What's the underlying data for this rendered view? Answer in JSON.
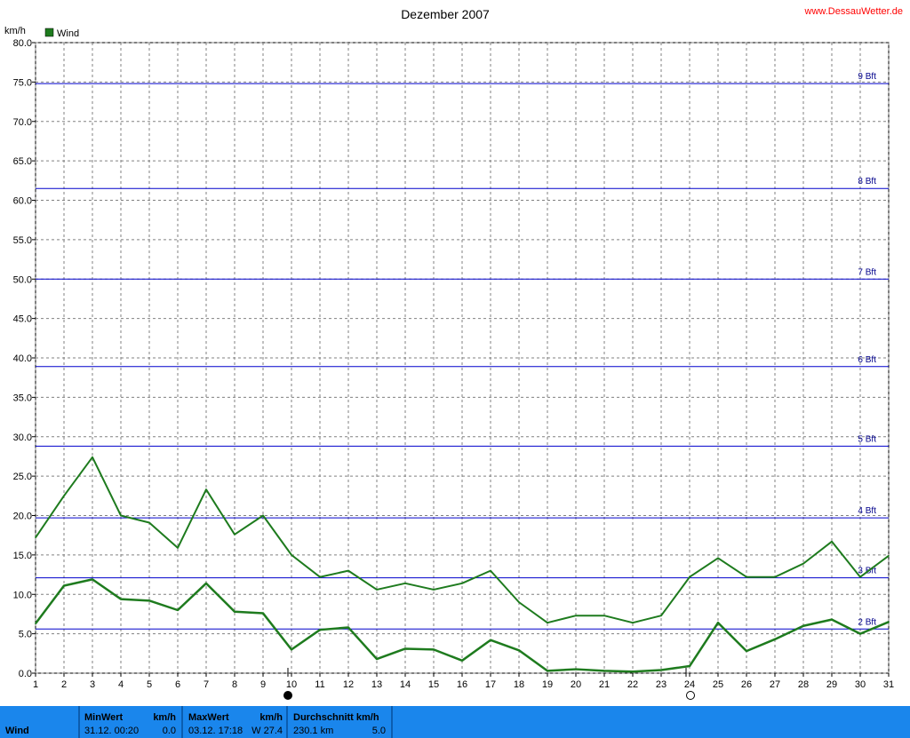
{
  "title": "Dezember 2007",
  "source": "www.DessauWetter.de",
  "y_unit": "km/h",
  "colors": {
    "series": "#1e7b1e",
    "beaufort": "#0000cc",
    "grid": "#808080",
    "footer": "#1a86ec"
  },
  "chart_data": {
    "type": "line",
    "title": "Dezember 2007",
    "ylabel": "km/h",
    "ylim": [
      0,
      80
    ],
    "xlim": [
      1,
      31
    ],
    "x": [
      1,
      2,
      3,
      4,
      5,
      6,
      7,
      8,
      9,
      10,
      11,
      12,
      13,
      14,
      15,
      16,
      17,
      18,
      19,
      20,
      21,
      22,
      23,
      24,
      25,
      26,
      27,
      28,
      29,
      30,
      31
    ],
    "y_ticks": [
      "0.0",
      "5.0",
      "10.0",
      "15.0",
      "20.0",
      "25.0",
      "30.0",
      "35.0",
      "40.0",
      "45.0",
      "50.0",
      "55.0",
      "60.0",
      "65.0",
      "70.0",
      "75.0",
      "80.0"
    ],
    "x_ticks": [
      "1",
      "2",
      "3",
      "4",
      "5",
      "6",
      "7",
      "8",
      "9",
      "10",
      "11",
      "12",
      "13",
      "14",
      "15",
      "16",
      "17",
      "18",
      "19",
      "20",
      "21",
      "22",
      "23",
      "24",
      "25",
      "26",
      "27",
      "28",
      "29",
      "30",
      "31"
    ],
    "legend": [
      "Wind"
    ],
    "series": [
      {
        "name": "Wind",
        "values": [
          17.2,
          22.5,
          27.4,
          20.0,
          19.1,
          15.9,
          23.3,
          17.6,
          20.0,
          15.0,
          12.2,
          13.0,
          10.6,
          11.4,
          10.6,
          11.4,
          13.0,
          9.0,
          6.4,
          7.3,
          7.3,
          6.4,
          7.3,
          12.2,
          14.6,
          12.2,
          12.2,
          13.9,
          16.7,
          12.2,
          14.9
        ]
      },
      {
        "values": [
          6.3,
          11.1,
          11.9,
          9.4,
          9.2,
          8.0,
          11.4,
          7.8,
          7.6,
          3.0,
          5.5,
          5.8,
          1.8,
          3.1,
          3.0,
          1.6,
          4.2,
          2.9,
          0.3,
          0.5,
          0.3,
          0.2,
          0.4,
          0.9,
          6.4,
          2.8,
          4.3,
          6.0,
          6.8,
          5.0,
          6.5
        ]
      }
    ],
    "reference_lines": [
      {
        "label": "2 Bft",
        "value": 5.6
      },
      {
        "label": "3 Bft",
        "value": 12.1
      },
      {
        "label": "4 Bft",
        "value": 19.7
      },
      {
        "label": "5 Bft",
        "value": 28.8
      },
      {
        "label": "6 Bft",
        "value": 38.9
      },
      {
        "label": "7 Bft",
        "value": 50.0
      },
      {
        "label": "8 Bft",
        "value": 61.5
      },
      {
        "label": "9 Bft",
        "value": 74.8
      }
    ],
    "moon_phases": [
      {
        "day": 10,
        "phase": "new-moon"
      },
      {
        "day": 24,
        "phase": "full-moon"
      }
    ],
    "grid": true,
    "legend_position": "top-left"
  },
  "footer": {
    "label": "Wind",
    "min": {
      "header": "MinWert",
      "unit": "km/h",
      "time": "31.12.  00:20",
      "value": "0.0"
    },
    "max": {
      "header": "MaxWert",
      "unit": "km/h",
      "time": "03.12.  17:18",
      "value": "W 27.4"
    },
    "avg": {
      "header": "Durchschnitt km/h",
      "distance": "230.1 km",
      "value": "5.0"
    }
  }
}
